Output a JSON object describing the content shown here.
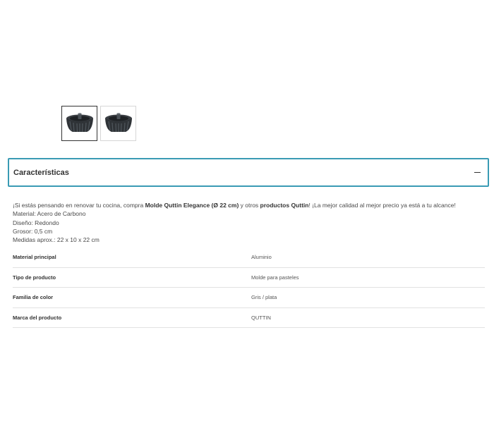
{
  "gallery": {
    "thumbnails": [
      {
        "icon": "bundt-pan-image",
        "selected": true
      },
      {
        "icon": "bundt-pan-image",
        "selected": false
      }
    ]
  },
  "accordion": {
    "title": "Características",
    "toggle_icon": "minus-icon"
  },
  "description": {
    "intro_prefix": "¡Si estás pensando en renovar tu cocina, compra ",
    "product_name": "Molde Quttin Elegance (Ø 22 cm)",
    "intro_middle": " y otros ",
    "brand_link": "productos Quttin",
    "intro_suffix": "! ¡La mejor calidad al mejor precio ya está a tu alcance!",
    "lines": [
      "Material: Acero de Carbono",
      "Diseño: Redondo",
      "Grosor: 0,5 cm",
      "Medidas aprox.: 22 x 10 x 22 cm"
    ]
  },
  "specs": [
    {
      "label": "Material principal",
      "value": "Aluminio"
    },
    {
      "label": "Tipo de producto",
      "value": "Molde para pasteles"
    },
    {
      "label": "Familia de color",
      "value": "Gris / plata"
    },
    {
      "label": "Marca del producto",
      "value": "QUTTIN"
    }
  ],
  "colors": {
    "accent": "#3a9bb4",
    "text": "#333333",
    "divider": "#e2e2e2"
  }
}
